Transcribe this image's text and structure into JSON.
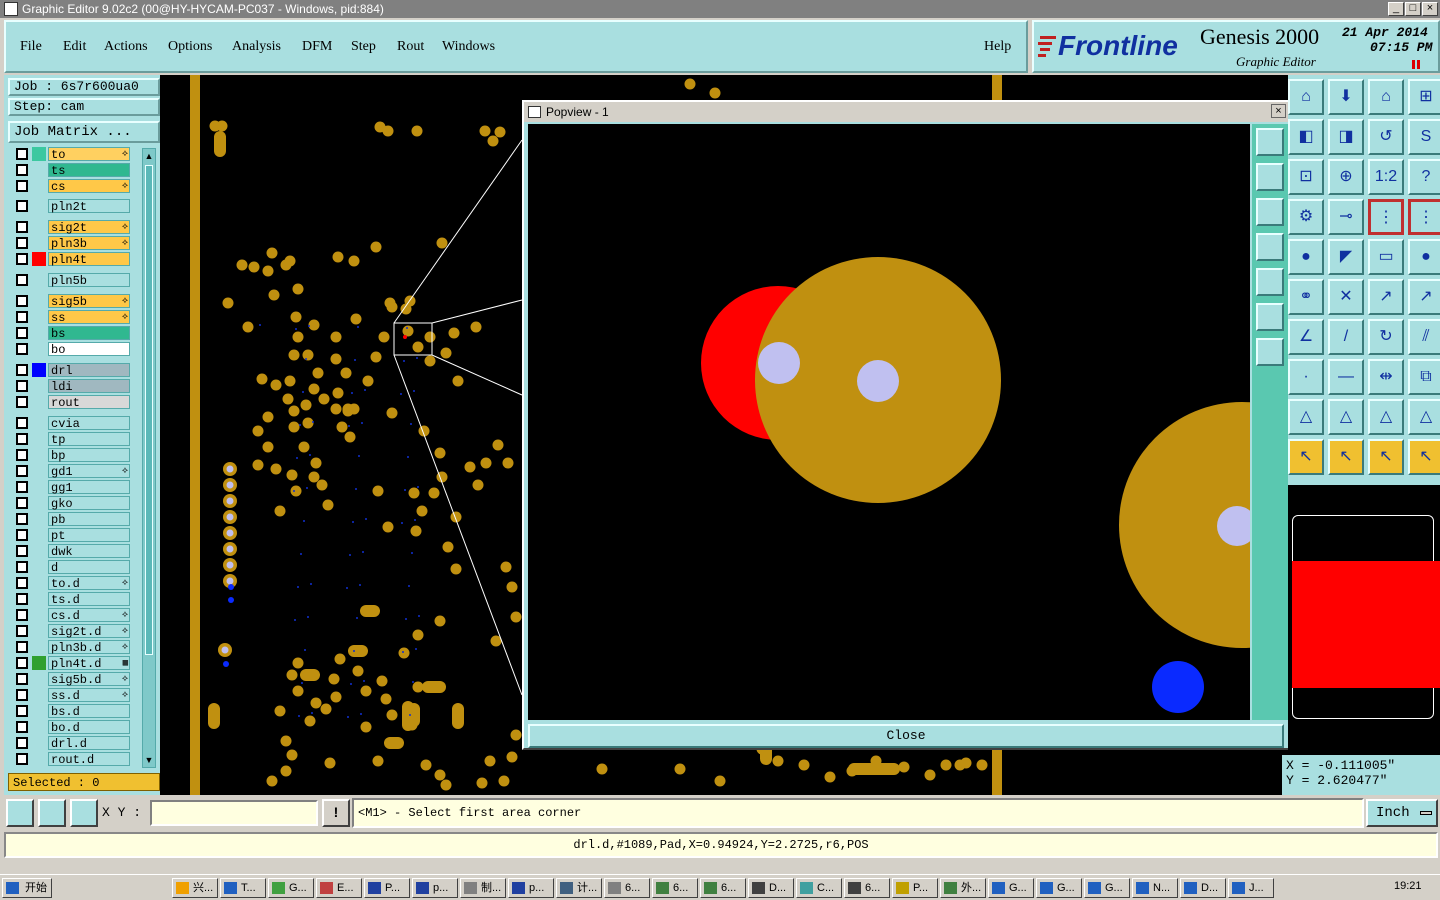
{
  "window": {
    "title": "Graphic Editor 9.02c2 (00@HY-HYCAM-PC037 - Windows, pid:884)",
    "controls": [
      "_",
      "□",
      "×"
    ]
  },
  "menu": {
    "items": [
      "File",
      "Edit",
      "Actions",
      "Options",
      "Analysis",
      "DFM",
      "Step",
      "Rout",
      "Windows"
    ],
    "help": "Help"
  },
  "brand": {
    "logo": "Frontline",
    "product": "Genesis 2000",
    "subtitle": "Graphic Editor",
    "date": "21 Apr 2014",
    "time": "07:15 PM"
  },
  "job": {
    "job_label": "Job : 6s7r600ua0",
    "step_label": "Step: cam",
    "matrix_button": "Job Matrix ..."
  },
  "layers": [
    {
      "name": "to",
      "color": "#3cc8a0",
      "bg": "#ffd060",
      "edit": "⟡"
    },
    {
      "name": "ts",
      "color": "",
      "bg": "#30b890",
      "edit": ""
    },
    {
      "name": "cs",
      "color": "",
      "bg": "#ffc848",
      "edit": "⟡"
    },
    {
      "name": "pln2t",
      "color": "",
      "bg": "#a9dfe0",
      "edit": ""
    },
    {
      "name": "sig2t",
      "color": "",
      "bg": "#ffc848",
      "edit": "⟡"
    },
    {
      "name": "pln3b",
      "color": "",
      "bg": "#ffc848",
      "edit": "⟡"
    },
    {
      "name": "pln4t",
      "color": "#ff0000",
      "bg": "#ffc848",
      "edit": ""
    },
    {
      "name": "pln5b",
      "color": "",
      "bg": "#a9dfe0",
      "edit": ""
    },
    {
      "name": "sig5b",
      "color": "",
      "bg": "#ffc848",
      "edit": "⟡"
    },
    {
      "name": "ss",
      "color": "",
      "bg": "#ffc848",
      "edit": "⟡"
    },
    {
      "name": "bs",
      "color": "",
      "bg": "#30b890",
      "edit": ""
    },
    {
      "name": "bo",
      "color": "",
      "bg": "#ffffff",
      "edit": ""
    },
    {
      "name": "drl",
      "color": "#0000ff",
      "bg": "#a0b8c0",
      "edit": ""
    },
    {
      "name": "ldi",
      "color": "",
      "bg": "#a0b8c0",
      "edit": ""
    },
    {
      "name": "rout",
      "color": "",
      "bg": "#d8d8d8",
      "edit": ""
    },
    {
      "name": "cvia",
      "color": "",
      "bg": "#a9dfe0",
      "edit": ""
    },
    {
      "name": "tp",
      "color": "",
      "bg": "#a9dfe0",
      "edit": ""
    },
    {
      "name": "bp",
      "color": "",
      "bg": "#a9dfe0",
      "edit": ""
    },
    {
      "name": "gd1",
      "color": "",
      "bg": "#a9dfe0",
      "edit": "⟡"
    },
    {
      "name": "gg1",
      "color": "",
      "bg": "#a9dfe0",
      "edit": ""
    },
    {
      "name": "gko",
      "color": "",
      "bg": "#a9dfe0",
      "edit": ""
    },
    {
      "name": "pb",
      "color": "",
      "bg": "#a9dfe0",
      "edit": ""
    },
    {
      "name": "pt",
      "color": "",
      "bg": "#a9dfe0",
      "edit": ""
    },
    {
      "name": "dwk",
      "color": "",
      "bg": "#a9dfe0",
      "edit": ""
    },
    {
      "name": "d",
      "color": "",
      "bg": "#a9dfe0",
      "edit": ""
    },
    {
      "name": "to.d",
      "color": "",
      "bg": "#a9dfe0",
      "edit": "⟡"
    },
    {
      "name": "ts.d",
      "color": "",
      "bg": "#a9dfe0",
      "edit": ""
    },
    {
      "name": "cs.d",
      "color": "",
      "bg": "#a9dfe0",
      "edit": "⟡"
    },
    {
      "name": "sig2t.d",
      "color": "",
      "bg": "#a9dfe0",
      "edit": "⟡"
    },
    {
      "name": "pln3b.d",
      "color": "",
      "bg": "#a9dfe0",
      "edit": "⟡"
    },
    {
      "name": "pln4t.d",
      "color": "#30a030",
      "bg": "#a9dfe0",
      "edit": "▦"
    },
    {
      "name": "sig5b.d",
      "color": "",
      "bg": "#a9dfe0",
      "edit": "⟡"
    },
    {
      "name": "ss.d",
      "color": "",
      "bg": "#a9dfe0",
      "edit": "⟡"
    },
    {
      "name": "bs.d",
      "color": "",
      "bg": "#a9dfe0",
      "edit": ""
    },
    {
      "name": "bo.d",
      "color": "",
      "bg": "#a9dfe0",
      "edit": ""
    },
    {
      "name": "drl.d",
      "color": "",
      "bg": "#a9dfe0",
      "edit": ""
    },
    {
      "name": "rout.d",
      "color": "",
      "bg": "#a9dfe0",
      "edit": ""
    }
  ],
  "selected": "Selected : 0",
  "popview": {
    "title": "Popview - 1",
    "close": "Close"
  },
  "coords": {
    "x": "X = -0.111005\"",
    "y": "Y = 2.620477\""
  },
  "command": {
    "xy_label": "X Y :",
    "xy_value": "",
    "prompt": "<M1> - Select first area corner",
    "units": "Inch"
  },
  "status": "drl.d,#1089,Pad,X=0.94924,Y=2.2725,r6,POS",
  "taskbar": {
    "start": "开始",
    "tasks": [
      "兴...",
      "T...",
      "G...",
      "E...",
      "P...",
      "p...",
      "制...",
      "p...",
      "计...",
      "6...",
      "6...",
      "6...",
      "D...",
      "C...",
      "6...",
      "P...",
      "外...",
      "G...",
      "G...",
      "G...",
      "N...",
      "D...",
      "J..."
    ],
    "clock": "19:21"
  },
  "colors": {
    "panel": "#a9dfe0",
    "pad": "#c09010",
    "plane": "#ff0000",
    "drill": "#c0c0f0",
    "via": "#0a2aff"
  }
}
